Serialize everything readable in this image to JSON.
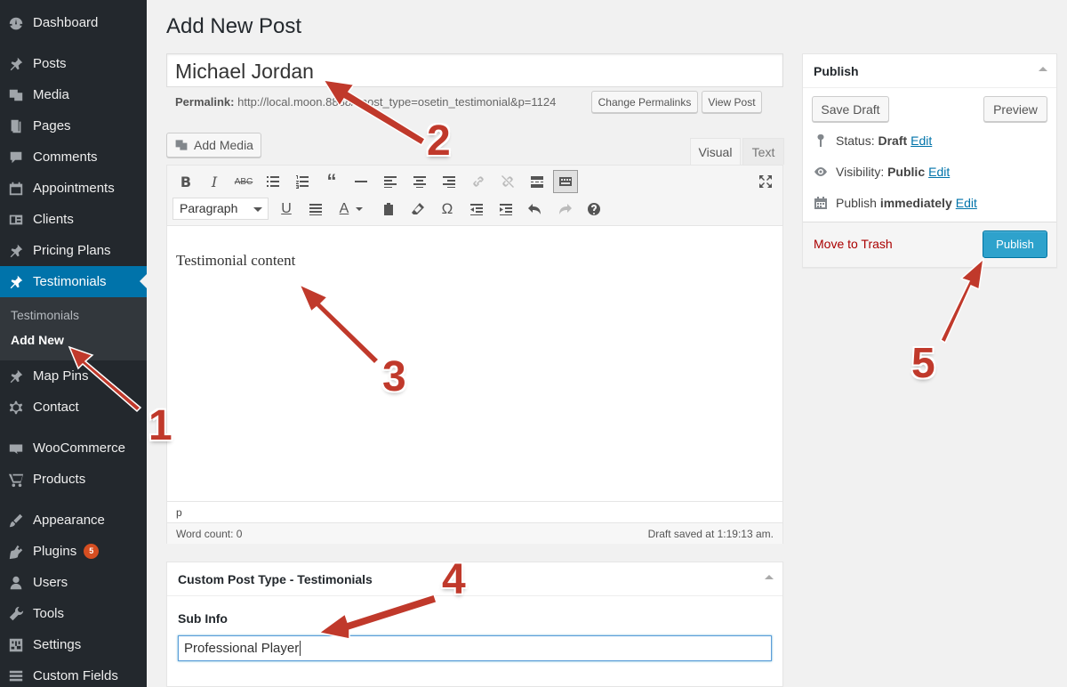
{
  "sidebar": {
    "items": [
      {
        "label": "Dashboard",
        "icon": "dashboard-icon"
      },
      {
        "label": "Posts",
        "icon": "pin-icon"
      },
      {
        "label": "Media",
        "icon": "media-icon"
      },
      {
        "label": "Pages",
        "icon": "pages-icon"
      },
      {
        "label": "Comments",
        "icon": "comments-icon"
      },
      {
        "label": "Appointments",
        "icon": "calendar-icon"
      },
      {
        "label": "Clients",
        "icon": "id-card-icon"
      },
      {
        "label": "Pricing Plans",
        "icon": "pin-icon"
      },
      {
        "label": "Testimonials",
        "icon": "pin-icon"
      },
      {
        "label": "Map Pins",
        "icon": "pin-icon"
      },
      {
        "label": "Contact",
        "icon": "gear-icon"
      },
      {
        "label": "WooCommerce",
        "icon": "woo-icon"
      },
      {
        "label": "Products",
        "icon": "cart-icon"
      },
      {
        "label": "Appearance",
        "icon": "brush-icon"
      },
      {
        "label": "Plugins",
        "icon": "plugin-icon",
        "badge": "5"
      },
      {
        "label": "Users",
        "icon": "user-icon"
      },
      {
        "label": "Tools",
        "icon": "wrench-icon"
      },
      {
        "label": "Settings",
        "icon": "settings-icon"
      },
      {
        "label": "Custom Fields",
        "icon": "fields-icon"
      }
    ],
    "submenu": {
      "all": "Testimonials",
      "add_new": "Add New"
    }
  },
  "main": {
    "page_title": "Add New Post",
    "title_value": "Michael Jordan",
    "permalink_label": "Permalink:",
    "permalink_url": "http://local.moon.8888/?post_type=osetin_testimonial&p=1124",
    "change_permalinks": "Change Permalinks",
    "view_post": "View Post",
    "add_media": "Add Media",
    "tab_visual": "Visual",
    "tab_text": "Text",
    "format_select": "Paragraph",
    "content": "Testimonial content",
    "path": "p",
    "word_count": "Word count: 0",
    "draft_saved": "Draft saved at 1:19:13 am."
  },
  "publish": {
    "title": "Publish",
    "save_draft": "Save Draft",
    "preview": "Preview",
    "status_label": "Status:",
    "status_value": "Draft",
    "visibility_label": "Visibility:",
    "visibility_value": "Public",
    "publish_label": "Publish",
    "publish_value": "immediately",
    "edit": "Edit",
    "move_to_trash": "Move to Trash",
    "publish_button": "Publish"
  },
  "metabox": {
    "title": "Custom Post Type - Testimonials",
    "field_label": "Sub Info",
    "field_value": "Professional Player"
  },
  "annotations": [
    "1",
    "2",
    "3",
    "4",
    "5"
  ],
  "colors": {
    "sidebar": "#23282d",
    "active": "#0073aa",
    "arrow": "#c0392b",
    "publish": "#2ea2cc"
  }
}
